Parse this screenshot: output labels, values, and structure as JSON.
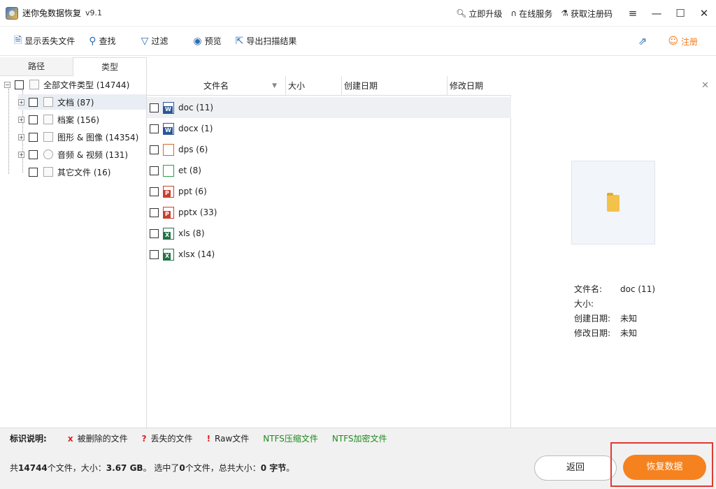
{
  "app": {
    "title": "迷你兔数据恢复",
    "version": "v9.1"
  },
  "title_links": [
    {
      "label": "立即升级",
      "icon": "search-icon"
    },
    {
      "label": "在线服务",
      "icon": "headset-icon"
    },
    {
      "label": "获取注册码",
      "icon": "cart-icon"
    }
  ],
  "toolbar": {
    "show_lost": "显示丢失文件",
    "find": "查找",
    "filter": "过滤",
    "preview": "预览",
    "export": "导出扫描结果",
    "register": "注册"
  },
  "tabs": [
    "路径",
    "类型"
  ],
  "active_tab": "类型",
  "tree": {
    "root": "全部文件类型 (14744)",
    "children": [
      "文档 (87)",
      "档案 (156)",
      "图形 & 图像 (14354)",
      "音频 & 视频 (131)",
      "其它文件 (16)"
    ]
  },
  "columns": [
    "文件名",
    "大小",
    "创建日期",
    "修改日期"
  ],
  "files": [
    {
      "name": "doc (11)",
      "icon": "word-icon",
      "color": "#2b5797",
      "tag": "W"
    },
    {
      "name": "docx (1)",
      "icon": "word-icon",
      "color": "#2b5797",
      "tag": "W"
    },
    {
      "name": "dps (6)",
      "icon": "presentation-icon",
      "color": "#d9662b",
      "tag": ""
    },
    {
      "name": "et (8)",
      "icon": "spreadsheet-icon",
      "color": "#2e9c4f",
      "tag": ""
    },
    {
      "name": "ppt (6)",
      "icon": "powerpoint-icon",
      "color": "#c9412c",
      "tag": "P"
    },
    {
      "name": "pptx (33)",
      "icon": "powerpoint-icon",
      "color": "#c9412c",
      "tag": "P"
    },
    {
      "name": "xls (8)",
      "icon": "excel-icon",
      "color": "#217346",
      "tag": "X"
    },
    {
      "name": "xlsx (14)",
      "icon": "excel-icon",
      "color": "#217346",
      "tag": "X"
    }
  ],
  "details": {
    "name_label": "文件名:",
    "name_value": "doc (11)",
    "size_label": "大小:",
    "size_value": "",
    "created_label": "创建日期:",
    "created_value": "未知",
    "modified_label": "修改日期:",
    "modified_value": "未知"
  },
  "legend": {
    "heading": "标识说明:",
    "items": [
      {
        "mark": "x",
        "label": "被删除的文件",
        "color": "#e02020"
      },
      {
        "mark": "?",
        "label": "丢失的文件",
        "color": "#e02020"
      },
      {
        "mark": "!",
        "label": "Raw文件",
        "color": "#e02020"
      },
      {
        "mark": "",
        "label": "NTFS压缩文件",
        "color": "#1f8a1f"
      },
      {
        "mark": "",
        "label": "NTFS加密文件",
        "color": "#1f8a1f"
      }
    ]
  },
  "status": {
    "p1": "共",
    "total": "14744",
    "p2": "个文件，大小：",
    "size": "3.67 GB",
    "p3": "。 选中了",
    "selected": "0",
    "p4": "个文件，总共大小：",
    "sel_size": "0 字节",
    "p5": "。"
  },
  "buttons": {
    "back": "返回",
    "recover": "恢复数据"
  },
  "colors": {
    "accent": "#f5821f",
    "highlight_frame": "#e03a2f"
  }
}
